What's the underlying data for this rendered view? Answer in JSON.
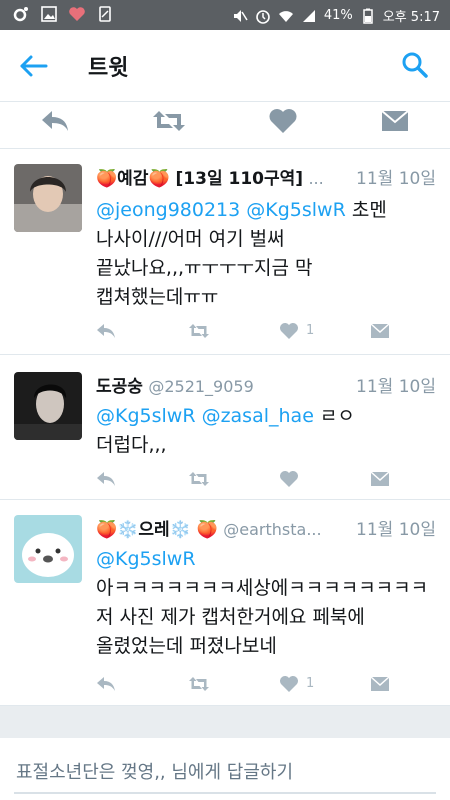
{
  "status_bar": {
    "battery_percent": "41%",
    "time": "오후 5:17"
  },
  "app_bar": {
    "title": "트윗",
    "back_icon": "arrow-left-icon",
    "search_icon": "search-icon"
  },
  "colors": {
    "accent": "#1da1f2",
    "action_gray": "#aab8c2",
    "main_action_gray": "#8899a6",
    "text": "#14171a",
    "secondary_text": "#8899a6"
  },
  "tweets": [
    {
      "name": "🍑예감🍑 [13일 110구역]",
      "handle_truncated": "...",
      "time": "11월 10일",
      "mentions": "@jeong980213 @Kg5slwR",
      "text_after_mentions": " 초멘",
      "text_lines": [
        "나사이///어머 여기 벌써",
        "끝났나요,,,ㅠㅜㅜㅜ지금 막",
        "캡쳐했는데ㅠㅠ"
      ],
      "like_count": "1"
    },
    {
      "name": "도공숭",
      "handle": "@2521_9059",
      "time": "11월 10일",
      "mentions": "@Kg5slwR @zasal_hae",
      "text_after_mentions": " ㄹㅇ",
      "text_lines": [
        "더럽다,,,"
      ],
      "like_count": ""
    },
    {
      "name": "🍑❄️으레❄️ 🍑",
      "handle": "@earthsta...",
      "time": "11월 10일",
      "mentions": "@Kg5slwR",
      "text_after_mentions": "",
      "text_lines": [
        "아ㅋㅋㅋㅋㅋㅋㅋ세상에ㅋㅋㅋㅋㅋㅋㅋㅋ",
        "저 사진 제가 캡처한거에요 페북에",
        "올렸었는데 퍼졌나보네"
      ],
      "like_count": "1"
    }
  ],
  "reply": {
    "placeholder": "표절소년단은 껒영,, 님에게 답글하기"
  }
}
